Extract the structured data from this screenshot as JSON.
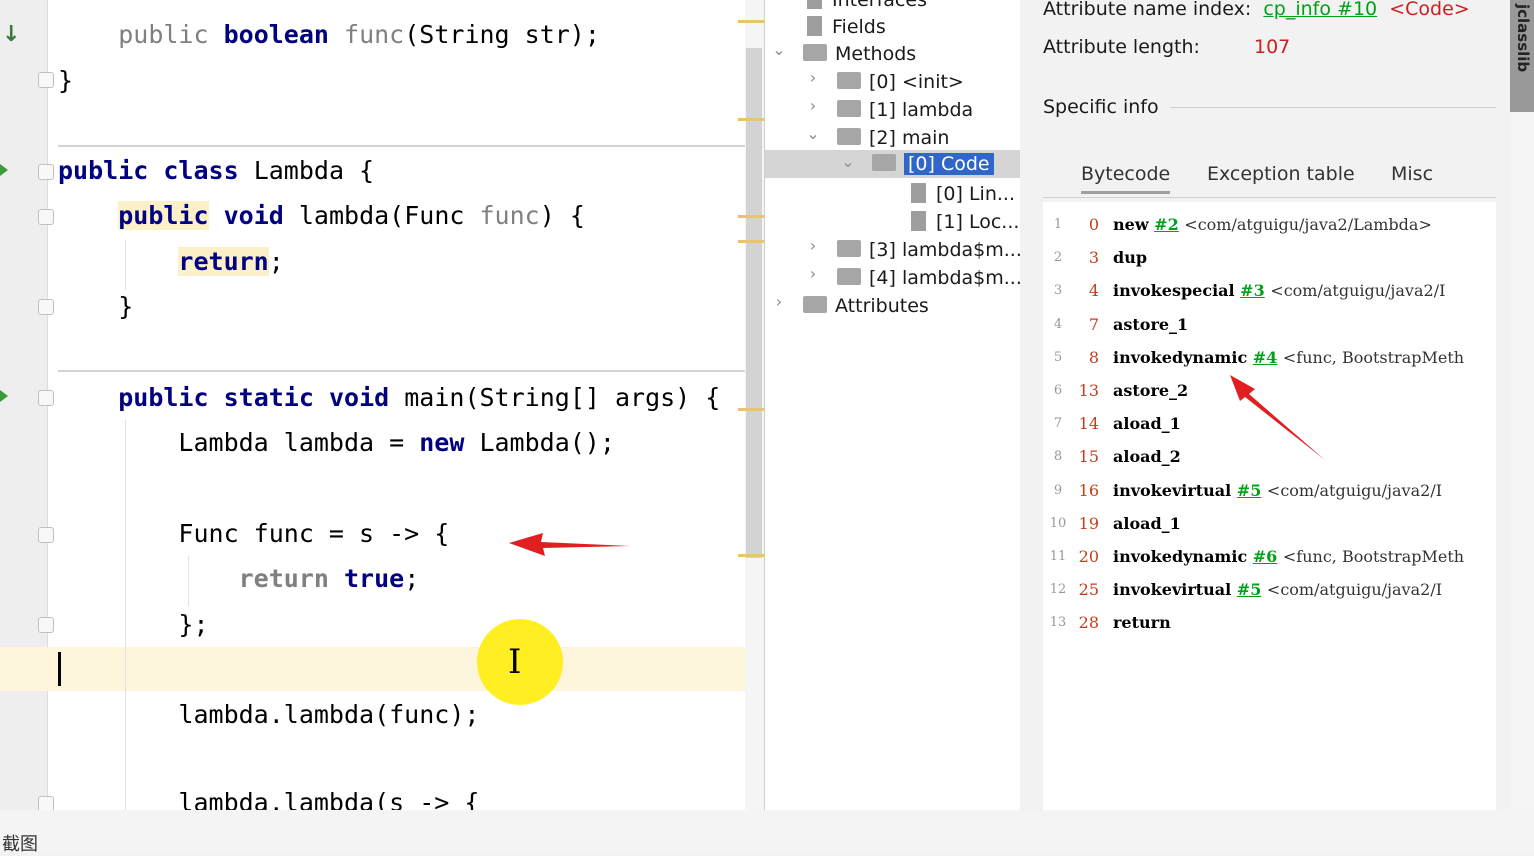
{
  "editor": {
    "lines": {
      "l1": {
        "indent": "    ",
        "kw1": "public",
        "kw2": "boolean",
        "name": "func",
        "rest": "(String str);"
      },
      "l2": "}",
      "l3": {
        "kw1": "public",
        "kw2": "class",
        "rest": "Lambda {"
      },
      "l4": {
        "indent": "    ",
        "kw1": "public",
        "kw2": "void",
        "name": "lambda(Func ",
        "param": "func",
        "rest": ") {"
      },
      "l5": {
        "indent": "        ",
        "kw": "return",
        "rest": ";"
      },
      "l6": "    }",
      "l7": {
        "indent": "    ",
        "kw1": "public",
        "kw2": "static",
        "kw3": "void",
        "rest": "main(String[] args) {"
      },
      "l8": {
        "pre": "        Lambda lambda = ",
        "kw": "new",
        "rest": "Lambda();"
      },
      "l9": "        Func func = s -> {",
      "l10": {
        "indent": "            ",
        "kw1": "return",
        "kw2": "true",
        "rest": ";"
      },
      "l11": "        };",
      "l12": "        lambda.lambda(func);",
      "l13": "        lambda.lambda(s -> {"
    }
  },
  "tree": {
    "interfaces": "Interfaces",
    "fields": "Fields",
    "methods": "Methods",
    "m0": "[0] <init>",
    "m1": "[1] lambda",
    "m2": "[2] main",
    "code": "[0] Code",
    "lin": "[0] Lin...",
    "loc": "[1] Loc...",
    "m3": "[3] lambda$m...",
    "m4": "[4] lambda$m...",
    "attributes": "Attributes"
  },
  "info": {
    "name_index_label": "Attribute name index:",
    "name_index_link": "cp_info #10",
    "name_index_value": "<Code>",
    "length_label": "Attribute length:",
    "length_value": "107",
    "specific_info": "Specific info"
  },
  "tabs": [
    "Bytecode",
    "Exception table",
    "Misc"
  ],
  "bytecode": [
    {
      "ln": "1",
      "off": "0",
      "op": "new",
      "ref": "#2",
      "comment": "<com/atguigu/java2/Lambda>"
    },
    {
      "ln": "2",
      "off": "3",
      "op": "dup",
      "ref": "",
      "comment": ""
    },
    {
      "ln": "3",
      "off": "4",
      "op": "invokespecial",
      "ref": "#3",
      "comment": "<com/atguigu/java2/I"
    },
    {
      "ln": "4",
      "off": "7",
      "op": "astore_1",
      "ref": "",
      "comment": ""
    },
    {
      "ln": "5",
      "off": "8",
      "op": "invokedynamic",
      "ref": "#4",
      "comment": "<func, BootstrapMeth"
    },
    {
      "ln": "6",
      "off": "13",
      "op": "astore_2",
      "ref": "",
      "comment": ""
    },
    {
      "ln": "7",
      "off": "14",
      "op": "aload_1",
      "ref": "",
      "comment": ""
    },
    {
      "ln": "8",
      "off": "15",
      "op": "aload_2",
      "ref": "",
      "comment": ""
    },
    {
      "ln": "9",
      "off": "16",
      "op": "invokevirtual",
      "ref": "#5",
      "comment": "<com/atguigu/java2/I"
    },
    {
      "ln": "10",
      "off": "19",
      "op": "aload_1",
      "ref": "",
      "comment": ""
    },
    {
      "ln": "11",
      "off": "20",
      "op": "invokedynamic",
      "ref": "#6",
      "comment": "<func, BootstrapMeth"
    },
    {
      "ln": "12",
      "off": "25",
      "op": "invokevirtual",
      "ref": "#5",
      "comment": "<com/atguigu/java2/I"
    },
    {
      "ln": "13",
      "off": "28",
      "op": "return",
      "ref": "",
      "comment": ""
    }
  ],
  "side_tab": "jclasslib",
  "bottom_label": "截图",
  "colors": {
    "keyword": "#000080",
    "link": "#00a018",
    "offset": "#c43d1a",
    "selection": "#2f66c8",
    "arrow": "#e02020",
    "cursor_highlight": "#ffee22"
  }
}
